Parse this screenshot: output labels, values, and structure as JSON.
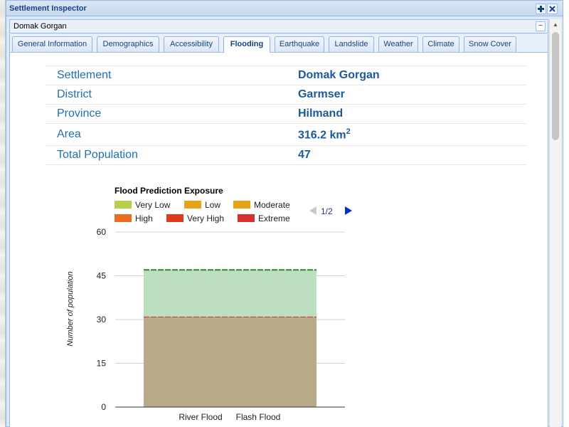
{
  "window": {
    "title": "Settlement Inspector",
    "pin_icon": "pin-icon",
    "close_icon": "close-icon"
  },
  "panel": {
    "title": "Domak Gorgan",
    "collapse_icon": "minus-icon"
  },
  "tabs": [
    {
      "label": "General Information"
    },
    {
      "label": "Demographics"
    },
    {
      "label": "Accessibility"
    },
    {
      "label": "Flooding",
      "active": true
    },
    {
      "label": "Earthquake"
    },
    {
      "label": "Landslide"
    },
    {
      "label": "Weather"
    },
    {
      "label": "Climate"
    },
    {
      "label": "Snow Cover"
    }
  ],
  "info": [
    {
      "label": "Settlement",
      "value": "Domak Gorgan"
    },
    {
      "label": "District",
      "value": "Garmser"
    },
    {
      "label": "Province",
      "value": "Hilmand"
    },
    {
      "label": "Area",
      "value": "316.2 km",
      "sup": "2"
    },
    {
      "label": "Total Population",
      "value": "47"
    }
  ],
  "legend": {
    "title": "Flood Prediction Exposure",
    "items": [
      {
        "label": "Very Low",
        "color": "#b8cc4e"
      },
      {
        "label": "Low",
        "color": "#e5a41a"
      },
      {
        "label": "Moderate",
        "color": "#e5a41a"
      },
      {
        "label": "High",
        "color": "#ee6c22"
      },
      {
        "label": "Very High",
        "color": "#e03a1e"
      },
      {
        "label": "Extreme",
        "color": "#d83030"
      }
    ],
    "pager": "1/2",
    "prev_icon": "triangle-left-icon",
    "next_icon": "triangle-right-icon"
  },
  "chart_data": {
    "type": "area",
    "x": [
      "River Flood",
      "Flash Flood"
    ],
    "ylabel": "Number of population",
    "ylim": [
      0,
      60
    ],
    "yticks": [
      0,
      15,
      30,
      45,
      60
    ],
    "series": [
      {
        "values": [
          31,
          31
        ],
        "color": "#b8a988",
        "line_color": "#d83030"
      },
      {
        "values": [
          47,
          47
        ],
        "color": "#bcdfbf",
        "line_color": "#2a8a2a"
      }
    ],
    "grid": true
  }
}
